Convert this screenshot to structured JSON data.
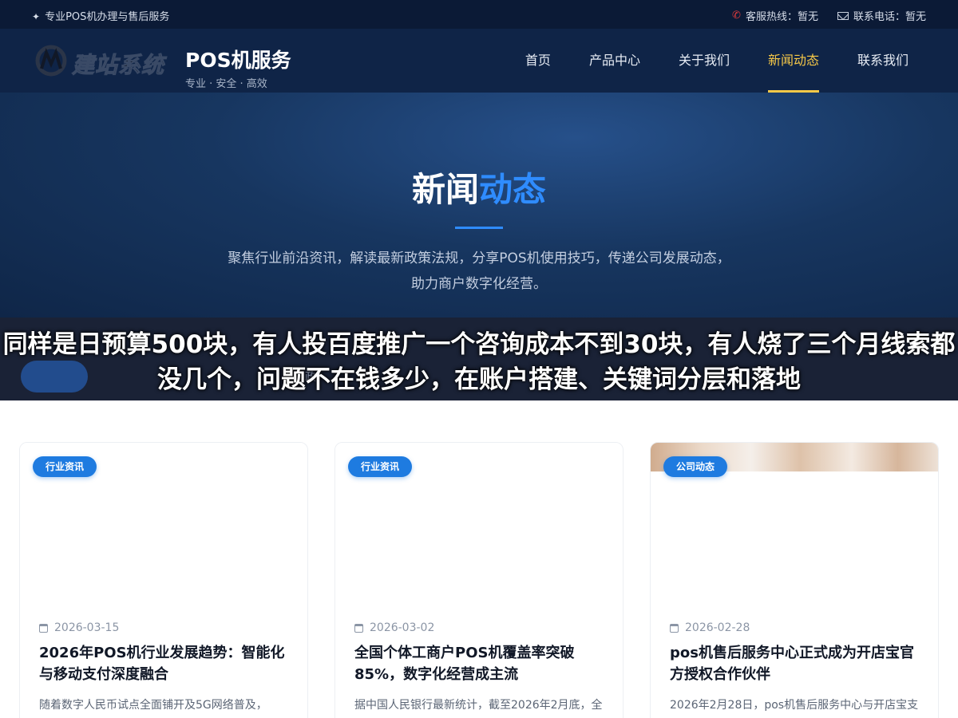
{
  "topbar": {
    "tagline": "专业POS机办理与售后服务",
    "hotline_label": "客服热线：",
    "hotline_value": "暂无",
    "phone_label": "联系电话：",
    "phone_value": "暂无"
  },
  "header": {
    "logo_text": "建站系统",
    "brand_name": "POS机服务",
    "brand_slogan": "专业 · 安全 · 高效",
    "nav": [
      "首页",
      "产品中心",
      "关于我们",
      "新闻动态",
      "联系我们"
    ],
    "active_nav": "新闻动态"
  },
  "hero": {
    "title_main": "新闻",
    "title_accent": "动态",
    "description": "聚焦行业前沿资讯，解读最新政策法规，分享POS机使用技巧，传递公司发展动态，助力商户数字化经营。"
  },
  "overlay": {
    "caption": "同样是日预算500块，有人投百度推广一个咨询成本不到30块，有人烧了三个月线索都没几个，问题不在钱多少，在账户搭建、关键词分层和落地",
    "faint_text": "政"
  },
  "articles": [
    {
      "category": "行业资讯",
      "date": "2026-03-15",
      "title": "2026年POS机行业发展趋势：智能化与移动支付深度融合",
      "excerpt": "随着数字人民币试点全面铺开及5G网络普及，"
    },
    {
      "category": "行业资讯",
      "date": "2026-03-02",
      "title": "全国个体工商户POS机覆盖率突破85%，数字化经营成主流",
      "excerpt": "据中国人民银行最新统计，截至2026年2月底，全"
    },
    {
      "category": "公司动态",
      "date": "2026-02-28",
      "title": "pos机售后服务中心正式成为开店宝官方授权合作伙伴",
      "excerpt": "2026年2月28日，pos机售后服务中心与开店宝支"
    }
  ],
  "colors": {
    "topbar_bg": "#0b1a36",
    "header_bg": "#0f2447",
    "accent_blue": "#2f8cff",
    "nav_active": "#f7c948",
    "badge_bg": "#1e7be0"
  }
}
